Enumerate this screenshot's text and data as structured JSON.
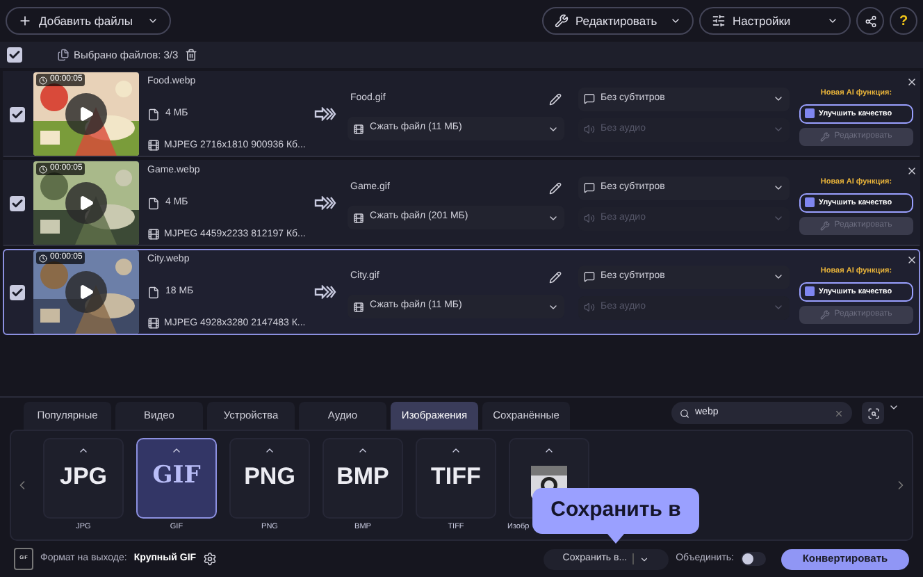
{
  "toolbar": {
    "add_files": "Добавить файлы",
    "edit": "Редактировать",
    "settings": "Настройки",
    "help": "?"
  },
  "selection": {
    "checked": true,
    "label": "Выбрано файлов: 3/3"
  },
  "files": [
    {
      "checked": true,
      "selected": false,
      "duration": "00:00:05",
      "name": "Food.webp",
      "size": "4 МБ",
      "codec": "MJPEG 2716x1810 900936 Кб...",
      "output_name": "Food.gif",
      "compression": "Сжать файл (11 МБ)",
      "subtitles": "Без субтитров",
      "audio": "Без аудио",
      "ai_label": "Новая AI функция:",
      "enhance": "Улучшить качество",
      "edit": "Редактировать"
    },
    {
      "checked": true,
      "selected": false,
      "duration": "00:00:05",
      "name": "Game.webp",
      "size": "4 МБ",
      "codec": "MJPEG 4459x2233 812197 Кб...",
      "output_name": "Game.gif",
      "compression": "Сжать файл (201 МБ)",
      "subtitles": "Без субтитров",
      "audio": "Без аудио",
      "ai_label": "Новая AI функция:",
      "enhance": "Улучшить качество",
      "edit": "Редактировать"
    },
    {
      "checked": true,
      "selected": true,
      "duration": "00:00:05",
      "name": "City.webp",
      "size": "18 МБ",
      "codec": "MJPEG 4928x3280 2147483 К...",
      "output_name": "City.gif",
      "compression": "Сжать файл (11 МБ)",
      "subtitles": "Без субтитров",
      "audio": "Без аудио",
      "ai_label": "Новая AI функция:",
      "enhance": "Улучшить качество",
      "edit": "Редактировать"
    }
  ],
  "format_tabs": [
    {
      "label": "Популярные",
      "selected": false
    },
    {
      "label": "Видео",
      "selected": false
    },
    {
      "label": "Устройства",
      "selected": false
    },
    {
      "label": "Аудио",
      "selected": false
    },
    {
      "label": "Изображения",
      "selected": true
    },
    {
      "label": "Сохранённые",
      "selected": false
    }
  ],
  "search": {
    "value": "webp"
  },
  "formats": [
    {
      "kind": "text",
      "logo": "JPG",
      "label": "JPG",
      "selected": false
    },
    {
      "kind": "text",
      "logo": "GIF",
      "label": "GIF",
      "selected": true
    },
    {
      "kind": "text",
      "logo": "PNG",
      "label": "PNG",
      "selected": false
    },
    {
      "kind": "text",
      "logo": "BMP",
      "label": "BMP",
      "selected": false
    },
    {
      "kind": "text",
      "logo": "TIFF",
      "label": "TIFF",
      "selected": false
    },
    {
      "kind": "camera",
      "label": "Изобр",
      "selected": false
    }
  ],
  "footer": {
    "format_badge": "GIF",
    "output_label": "Формат на выходе:",
    "output_format": "Крупный GIF",
    "save_to": "Сохранить в...",
    "merge_label": "Объединить:",
    "merge_on": false,
    "convert": "Конвертировать"
  },
  "tooltip": {
    "text": "Сохранить в"
  }
}
